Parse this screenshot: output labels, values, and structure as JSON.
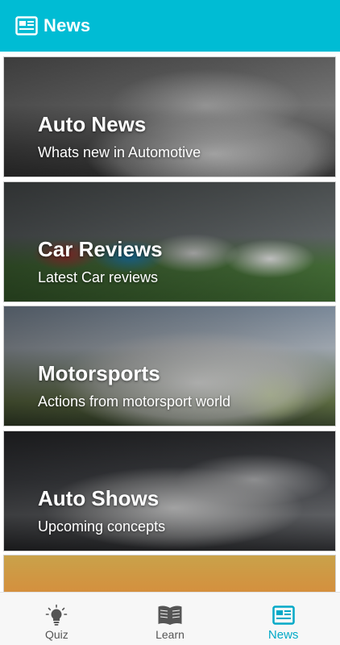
{
  "app_bar": {
    "title": "News",
    "icon": "newspaper-icon",
    "color": "#00bcd4"
  },
  "cards": [
    {
      "title": "Auto News",
      "subtitle": "Whats new in Automotive"
    },
    {
      "title": "Car Reviews",
      "subtitle": "Latest Car reviews"
    },
    {
      "title": "Motorsports",
      "subtitle": "Actions from motorsport world"
    },
    {
      "title": "Auto Shows",
      "subtitle": "Upcoming concepts"
    }
  ],
  "bottom_nav": {
    "items": [
      {
        "label": "Quiz",
        "icon": "lightbulb-icon"
      },
      {
        "label": "Learn",
        "icon": "book-icon"
      },
      {
        "label": "News",
        "icon": "newspaper-icon",
        "active": true
      }
    ],
    "active_color": "#00a9c7"
  }
}
